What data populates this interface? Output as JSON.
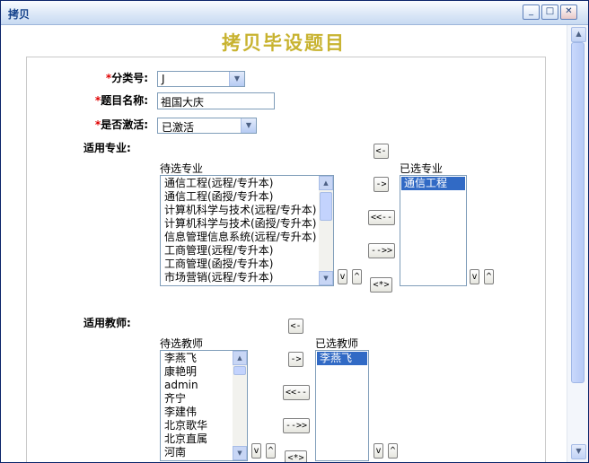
{
  "window": {
    "title": "拷贝",
    "controls": {
      "minimize": "_",
      "maximize": "□",
      "close": "✕"
    }
  },
  "page": {
    "title": "拷贝毕设题目"
  },
  "form": {
    "category": {
      "required_mark": "*",
      "label": "分类号:",
      "value": "J"
    },
    "topic_name": {
      "required_mark": "*",
      "label": "题目名称:",
      "value": "祖国大庆"
    },
    "active": {
      "required_mark": "*",
      "label": "是否激活:",
      "value": "已激活"
    },
    "majors": {
      "label": "适用专业:",
      "available_caption": "待选专业",
      "selected_caption": "已选专业",
      "available": [
        "通信工程(远程/专升本)",
        "通信工程(函授/专升本)",
        "计算机科学与技术(远程/专升本)",
        "计算机科学与技术(函授/专升本)",
        "信息管理信息系统(远程/专升本)",
        "工商管理(远程/专升本)",
        "工商管理(函授/专升本)",
        "市场营销(远程/专升本)"
      ],
      "selected": [
        "通信工程"
      ],
      "buttons": {
        "move_left": "<-",
        "move_right": "->",
        "move_all_left": "<<--",
        "move_all_right": "-->>",
        "reset": "<*>",
        "down": "v",
        "up": "^"
      }
    },
    "teachers": {
      "label": "适用教师:",
      "available_caption": "待选教师",
      "selected_caption": "已选教师",
      "available": [
        "李燕飞",
        "康艳明",
        "admin",
        "齐宁",
        "李建伟",
        "北京歌华",
        "北京直属",
        "河南"
      ],
      "selected": [
        "李燕飞"
      ],
      "buttons": {
        "move_left": "<-",
        "move_right": "->",
        "move_all_left": "<<--",
        "move_all_right": "-->>",
        "reset": "<*>",
        "down": "v",
        "up": "^"
      }
    }
  },
  "colors": {
    "title_gold": "#c8b330",
    "required_red": "#e00000",
    "selection_blue": "#316ac5"
  },
  "icons": {
    "dropdown": "chevron-down-icon",
    "scroll_up": "arrow-up-icon",
    "scroll_down": "arrow-down-icon"
  }
}
